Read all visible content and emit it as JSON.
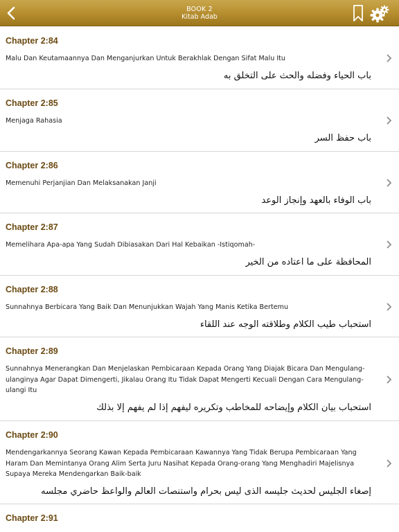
{
  "header": {
    "book": "BOOK 2",
    "subtitle": "Kitab Adab",
    "back_icon": "chevron-left-icon",
    "bookmark_icon": "bookmark-icon",
    "settings_icon": "gear-icon"
  },
  "colors": {
    "navbar_gold": "#b58d2e",
    "chapter_brown": "#6b4a12",
    "divider": "#d6d6d6"
  },
  "chapters": [
    {
      "title": "Chapter 2:84",
      "latin": "Malu Dan Keutamaannya Dan Menganjurkan Untuk Berakhlak Dengan Sifat Malu Itu",
      "arabic": "باب الحياء وفضله والحث على التخلق به"
    },
    {
      "title": "Chapter 2:85",
      "latin": "Menjaga Rahasia",
      "arabic": "باب حفظ السر"
    },
    {
      "title": "Chapter 2:86",
      "latin": "Memenuhi Perjanjian Dan Melaksanakan Janji",
      "arabic": "باب الوفاء بالعهد وإنجاز الوعد"
    },
    {
      "title": "Chapter 2:87",
      "latin": "Memelihara Apa-apa Yang Sudah Dibiasakan Dari Hal Kebaikan -Istiqomah-",
      "arabic": "المحافظة على ما اعتاده من الخير"
    },
    {
      "title": "Chapter 2:88",
      "latin": "Sunnahnya Berbicara Yang Baik Dan Menunjukkan Wajah Yang Manis Ketika Bertemu",
      "arabic": "استحباب طيب الكلام وطلاقته الوجه عند اللقاء"
    },
    {
      "title": "Chapter 2:89",
      "latin": "Sunnahnya Menerangkan Dan Menjelaskan Pembicaraan Kepada Orang Yang Diajak Bicara Dan Mengulang-ulanginya Agar Dapat Dimengerti, Jikalau Orang Itu Tidak Dapat Mengerti Kecuali Dengan Cara Mengulang-ulangi Itu",
      "arabic": "استحباب بيان الكلام وإيضاحه للمخاطب وتكريره ليفهم إذا لم يفهم إلا بذلك"
    },
    {
      "title": "Chapter 2:90",
      "latin": "Mendengarkannya Seorang Kawan Kepada Pembicaraan Kawannya Yang Tidak Berupa Pembicaraan Yang Haram Dan Memintanya Orang Alim Serta Juru Nasihat Kepada Orang-orang Yang Menghadiri Majelisnya Supaya Mereka Mendengarkan Baik-baik",
      "arabic": "إصغاء الجليس لحديث جليسه الذى ليس بحرام واستنصات العالم والواعظ حاضري مجلسه"
    },
    {
      "title": "Chapter 2:91",
      "latin": "",
      "arabic": ""
    }
  ]
}
